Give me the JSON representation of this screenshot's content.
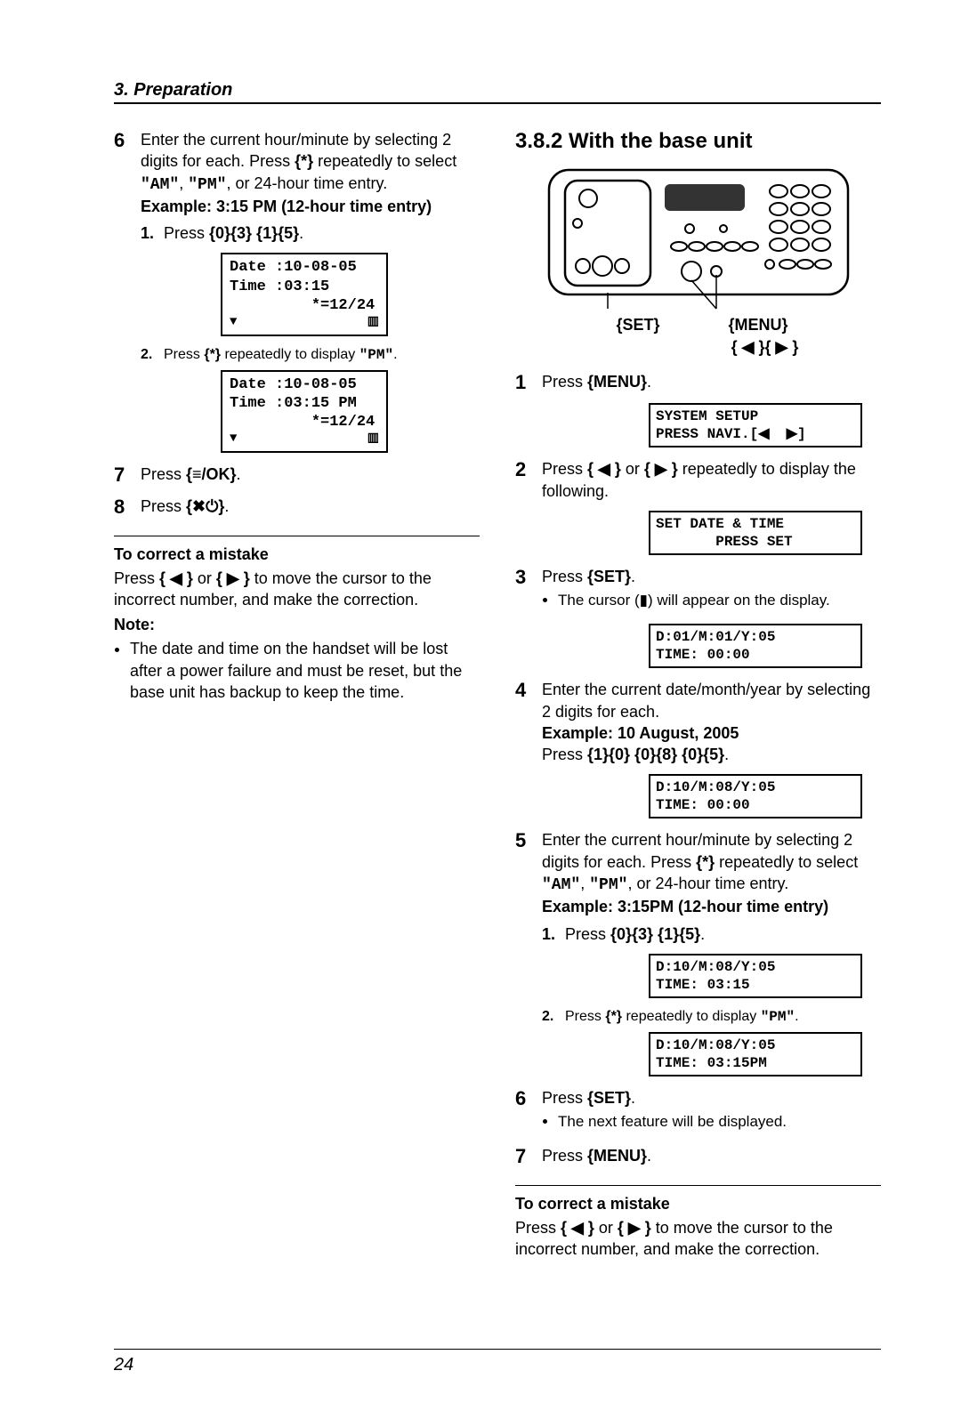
{
  "header": {
    "title": "3. Preparation"
  },
  "left": {
    "step6": {
      "num": "6",
      "text_a": "Enter the current hour/minute by selecting 2 digits for each. Press ",
      "key1": "{*}",
      "text_b": " repeatedly to select ",
      "q1": "\"AM\"",
      "text_c": ", ",
      "q2": "\"PM\"",
      "text_d": ", or 24-hour time entry.",
      "example": "Example: 3:15 PM (12-hour time entry)",
      "sub1_num": "1.",
      "sub1_a": "Press ",
      "sub1_keys": "{0}{3} {1}{5}",
      "sub1_b": ".",
      "display1": "Date :10-08-05\nTime :03:15\n         *=12/24",
      "sub2_num": "2.",
      "sub2_a": "Press ",
      "sub2_key": "{*}",
      "sub2_b": " repeatedly to display ",
      "sub2_q": "\"PM\"",
      "sub2_c": ".",
      "display2": "Date :10-08-05\nTime :03:15 PM\n         *=12/24"
    },
    "step7": {
      "num": "7",
      "text_a": "Press ",
      "key": "{≡/OK}",
      "text_b": "."
    },
    "step8": {
      "num": "8",
      "text_a": "Press ",
      "key": "{✖⏻}",
      "text_b": "."
    },
    "correct_head": "To correct a mistake",
    "correct_text_a": "Press ",
    "correct_key1": "{ ◀ }",
    "correct_text_b": " or ",
    "correct_key2": "{ ▶ }",
    "correct_text_c": " to move the cursor to the incorrect number, and make the correction.",
    "note_head": "Note:",
    "note_bullet": "The date and time on the handset will be lost after a power failure and must be reset, but the base unit has backup to keep the time."
  },
  "right": {
    "section_title": "3.8.2 With the base unit",
    "labels": {
      "set": "{SET}",
      "menu": "{MENU}",
      "arrows": "{ ◀ }{ ▶ }"
    },
    "step1": {
      "num": "1",
      "a": "Press ",
      "key": "{MENU}",
      "b": ".",
      "display": "SYSTEM SETUP\nPRESS NAVI.[◀  ▶]"
    },
    "step2": {
      "num": "2",
      "a": "Press ",
      "k1": "{ ◀ }",
      "b": " or ",
      "k2": "{ ▶ }",
      "c": " repeatedly to display the following.",
      "display": "SET DATE & TIME\n       PRESS SET"
    },
    "step3": {
      "num": "3",
      "a": "Press ",
      "key": "{SET}",
      "b": ".",
      "bullet": "The cursor (▮) will appear on the display.",
      "display": "D:01/M:01/Y:05\nTIME: 00:00"
    },
    "step4": {
      "num": "4",
      "a": "Enter the current date/month/year by selecting 2 digits for each.",
      "example": "Example: 10 August, 2005",
      "press_a": "Press ",
      "keys": "{1}{0} {0}{8} {0}{5}",
      "press_b": ".",
      "display": "D:10/M:08/Y:05\nTIME: 00:00"
    },
    "step5": {
      "num": "5",
      "a": "Enter the current hour/minute by selecting 2 digits for each. Press ",
      "k_star": "{*}",
      "b": " repeatedly to select ",
      "q1": "\"AM\"",
      "c": ", ",
      "q2": "\"PM\"",
      "d": ", or 24-hour time entry.",
      "example": "Example: 3:15PM (12-hour time entry)",
      "sub1_num": "1.",
      "sub1_a": "Press ",
      "sub1_keys": "{0}{3} {1}{5}",
      "sub1_b": ".",
      "display1": "D:10/M:08/Y:05\nTIME: 03:15",
      "sub2_num": "2.",
      "sub2_a": "Press ",
      "sub2_k": "{*}",
      "sub2_b": " repeatedly to display ",
      "sub2_q": "\"PM\"",
      "sub2_c": ".",
      "display2": "D:10/M:08/Y:05\nTIME: 03:15PM"
    },
    "step6": {
      "num": "6",
      "a": "Press ",
      "key": "{SET}",
      "b": ".",
      "bullet": "The next feature will be displayed."
    },
    "step7": {
      "num": "7",
      "a": "Press ",
      "key": "{MENU}",
      "b": "."
    },
    "correct_head": "To correct a mistake",
    "correct_a": "Press ",
    "correct_k1": "{ ◀ }",
    "correct_b": " or ",
    "correct_k2": "{ ▶ }",
    "correct_c": " to move the cursor to the incorrect number, and make the correction."
  },
  "footer": {
    "page": "24"
  }
}
